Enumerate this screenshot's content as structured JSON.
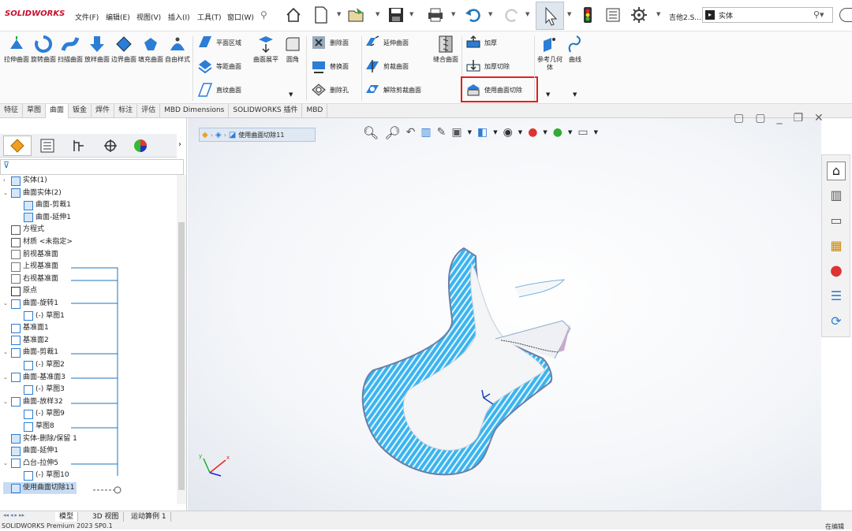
{
  "app": {
    "logo": "SOLIDWORKS",
    "status_text": "SOLIDWORKS Premium 2023 SP0.1",
    "status_right": "在编辑"
  },
  "menus": [
    "文件(F)",
    "编辑(E)",
    "视图(V)",
    "插入(I)",
    "工具(T)",
    "窗口(W)"
  ],
  "title_doc": "吉他2.S...",
  "search": {
    "value": "实体"
  },
  "ribbon": {
    "big": [
      "拉伸曲面",
      "旋转曲面",
      "扫描曲面",
      "放样曲面",
      "边界曲面",
      "填充曲面",
      "自由样式"
    ],
    "col2": [
      "平面区域",
      "等距曲面",
      "直纹曲面"
    ],
    "c3": "曲面展平",
    "c4": "圆角",
    "col5": [
      "删除面",
      "替换面",
      "删除孔"
    ],
    "col6": [
      "延伸曲面",
      "剪裁曲面",
      "解除剪裁曲面"
    ],
    "c7": "缝合曲面",
    "col8": [
      "加厚",
      "加厚切除",
      "使用曲面切除"
    ],
    "c9": "参考几何体",
    "c10": "曲线"
  },
  "tabs": [
    "特征",
    "草图",
    "曲面",
    "钣金",
    "焊件",
    "标注",
    "评估",
    "MBD Dimensions",
    "SOLIDWORKS 插件",
    "MBD"
  ],
  "breadcrumb": "使用曲面切除11",
  "tree": [
    {
      "label": "实体(1)",
      "lvl": 0,
      "exp": "›"
    },
    {
      "label": "曲面实体(2)",
      "lvl": 0,
      "exp": "⌄"
    },
    {
      "label": "曲面-剪裁1",
      "lvl": 1,
      "exp": ""
    },
    {
      "label": "曲面-延伸1",
      "lvl": 1,
      "exp": ""
    },
    {
      "label": "方程式",
      "lvl": 0,
      "exp": ""
    },
    {
      "label": "材质 <未指定>",
      "lvl": 0,
      "exp": ""
    },
    {
      "label": "前视基准面",
      "lvl": 0,
      "exp": ""
    },
    {
      "label": "上视基准面",
      "lvl": 0,
      "exp": ""
    },
    {
      "label": "右视基准面",
      "lvl": 0,
      "exp": ""
    },
    {
      "label": "原点",
      "lvl": 0,
      "exp": ""
    },
    {
      "label": "曲面-旋转1",
      "lvl": 0,
      "exp": "⌄"
    },
    {
      "label": "(-) 草图1",
      "lvl": 1,
      "exp": ""
    },
    {
      "label": "基准面1",
      "lvl": 0,
      "exp": ""
    },
    {
      "label": "基准面2",
      "lvl": 0,
      "exp": ""
    },
    {
      "label": "曲面-剪裁1",
      "lvl": 0,
      "exp": "⌄"
    },
    {
      "label": "(-) 草图2",
      "lvl": 1,
      "exp": ""
    },
    {
      "label": "曲面-基准面3",
      "lvl": 0,
      "exp": "⌄"
    },
    {
      "label": "(-) 草图3",
      "lvl": 1,
      "exp": ""
    },
    {
      "label": "曲面-放样32",
      "lvl": 0,
      "exp": "⌄"
    },
    {
      "label": "(-) 草图9",
      "lvl": 1,
      "exp": ""
    },
    {
      "label": "草图8",
      "lvl": 1,
      "exp": ""
    },
    {
      "label": "实体-删除/保留 1",
      "lvl": 0,
      "exp": ""
    },
    {
      "label": "曲面-延伸1",
      "lvl": 0,
      "exp": ""
    },
    {
      "label": "凸台-拉伸5",
      "lvl": 0,
      "exp": "⌄"
    },
    {
      "label": "(-) 草图10",
      "lvl": 1,
      "exp": ""
    },
    {
      "label": "使用曲面切除11",
      "lvl": 0,
      "exp": ""
    }
  ],
  "bottom_tabs": [
    "模型",
    "3D 视图",
    "运动算例 1"
  ],
  "colors": {
    "accent": "#1c75bc",
    "highlight_box": "#e02020",
    "surface_blue": "#2aa9e8"
  }
}
